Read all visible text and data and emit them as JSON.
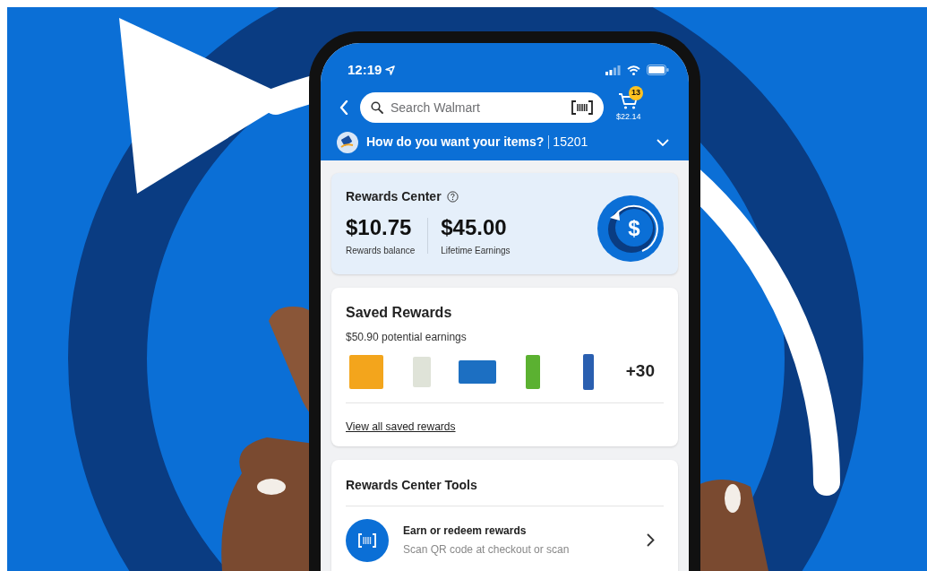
{
  "status_bar": {
    "time": "12:19"
  },
  "search": {
    "placeholder": "Search Walmart"
  },
  "cart": {
    "count": "13",
    "total": "$22.14"
  },
  "delivery": {
    "prompt": "How do you want your items?",
    "zip": "15201"
  },
  "rewards_center": {
    "title": "Rewards Center",
    "icon_symbol": "$",
    "stats": [
      {
        "value": "$10.75",
        "label": "Rewards balance"
      },
      {
        "value": "$45.00",
        "label": "Lifetime Earnings"
      }
    ]
  },
  "saved_rewards": {
    "title": "Saved Rewards",
    "subtitle": "$50.90 potential earnings",
    "more_count": "+30",
    "link": "View all saved rewards"
  },
  "tools": {
    "title": "Rewards Center Tools",
    "items": [
      {
        "title": "Earn or redeem rewards",
        "description": "Scan QR code at checkout or scan"
      }
    ]
  }
}
